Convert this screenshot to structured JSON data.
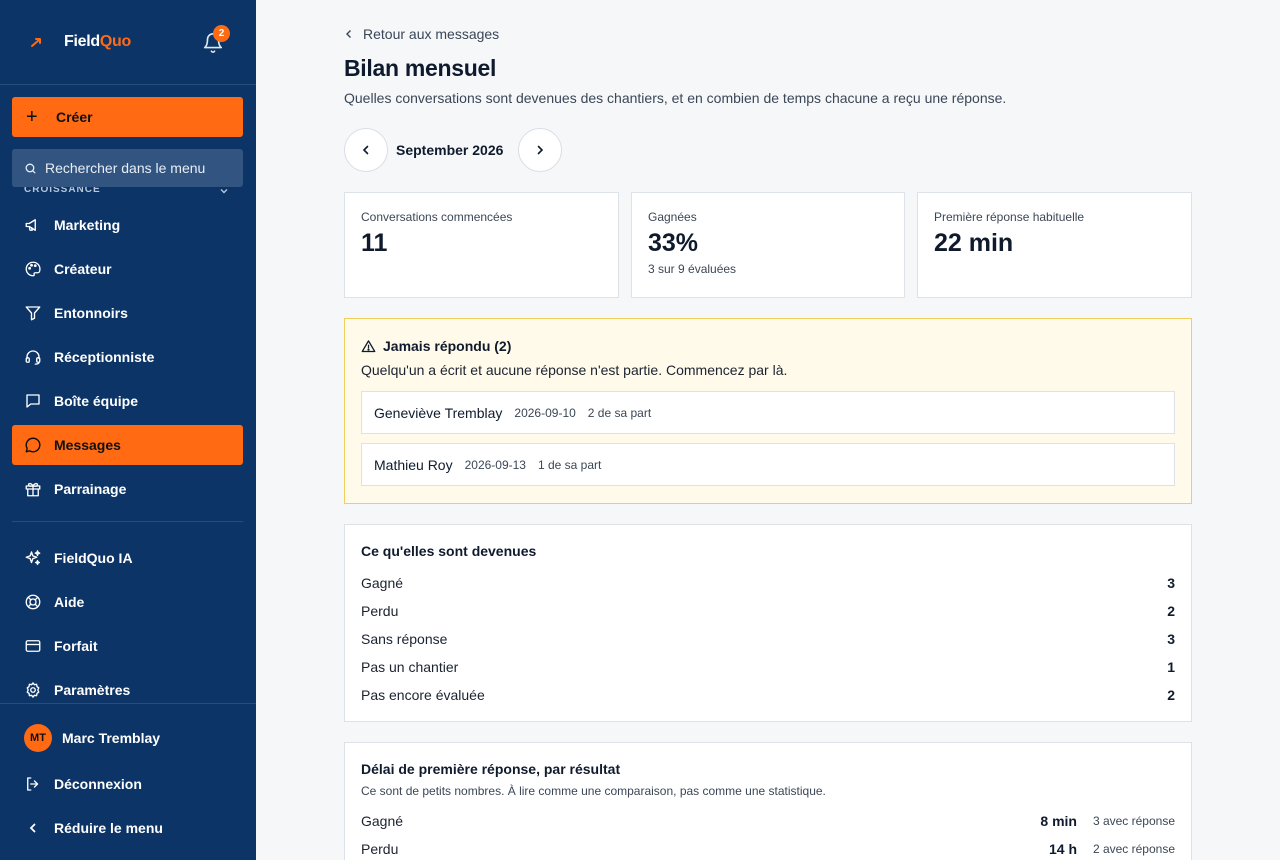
{
  "brand": {
    "name_part1": "Field",
    "name_part2": "Quo"
  },
  "notifications": {
    "count": "2"
  },
  "sidebar": {
    "create_label": "Créer",
    "search_placeholder": "Rechercher dans le menu",
    "group_label": "CROISSANCE",
    "items": [
      {
        "label": "Marketing",
        "icon": "megaphone-icon"
      },
      {
        "label": "Créateur",
        "icon": "palette-icon"
      },
      {
        "label": "Entonnoirs",
        "icon": "funnel-icon"
      },
      {
        "label": "Réceptionniste",
        "icon": "headset-icon"
      },
      {
        "label": "Boîte équipe",
        "icon": "inbox-icon"
      },
      {
        "label": "Messages",
        "icon": "chat-icon",
        "active": true
      },
      {
        "label": "Parrainage",
        "icon": "gift-icon"
      }
    ],
    "secondary": [
      {
        "label": "FieldQuo IA",
        "icon": "sparkles-icon"
      },
      {
        "label": "Aide",
        "icon": "lifebuoy-icon"
      },
      {
        "label": "Forfait",
        "icon": "credit-card-icon"
      },
      {
        "label": "Paramètres",
        "icon": "gear-icon"
      }
    ],
    "user": {
      "initials": "MT",
      "name": "Marc Tremblay"
    },
    "logout_label": "Déconnexion",
    "collapse_label": "Réduire le menu"
  },
  "header": {
    "back_label": "Retour aux messages",
    "title": "Bilan mensuel",
    "subtitle": "Quelles conversations sont devenues des chantiers, et en combien de temps chacune a reçu une réponse.",
    "period": "September 2026"
  },
  "stats": [
    {
      "label": "Conversations commencées",
      "value": "11",
      "note": ""
    },
    {
      "label": "Gagnées",
      "value": "33%",
      "note": "3 sur 9 évaluées"
    },
    {
      "label": "Première réponse habituelle",
      "value": "22 min",
      "note": ""
    }
  ],
  "alert": {
    "title": "Jamais répondu (2)",
    "text": "Quelqu'un a écrit et aucune réponse n'est partie. Commencez par là.",
    "rows": [
      {
        "name": "Geneviève Tremblay",
        "date": "2026-09-10",
        "count": "2 de sa part"
      },
      {
        "name": "Mathieu Roy",
        "date": "2026-09-13",
        "count": "1 de sa part"
      }
    ]
  },
  "outcomes": {
    "title": "Ce qu'elles sont devenues",
    "rows": [
      {
        "label": "Gagné",
        "value": "3"
      },
      {
        "label": "Perdu",
        "value": "2"
      },
      {
        "label": "Sans réponse",
        "value": "3"
      },
      {
        "label": "Pas un chantier",
        "value": "1"
      },
      {
        "label": "Pas encore évaluée",
        "value": "2"
      }
    ]
  },
  "delay": {
    "title": "Délai de première réponse, par résultat",
    "subtitle": "Ce sont de petits nombres. À lire comme une comparaison, pas comme une statistique.",
    "rows": [
      {
        "label": "Gagné",
        "value": "8 min",
        "meta": "3 avec réponse"
      },
      {
        "label": "Perdu",
        "value": "14 h",
        "meta": "2 avec réponse"
      }
    ]
  },
  "colors": {
    "sidebar": "#0c3466",
    "accent": "#ff6a13",
    "alert_bg": "#fffaea",
    "alert_border": "#f2cf5c"
  }
}
